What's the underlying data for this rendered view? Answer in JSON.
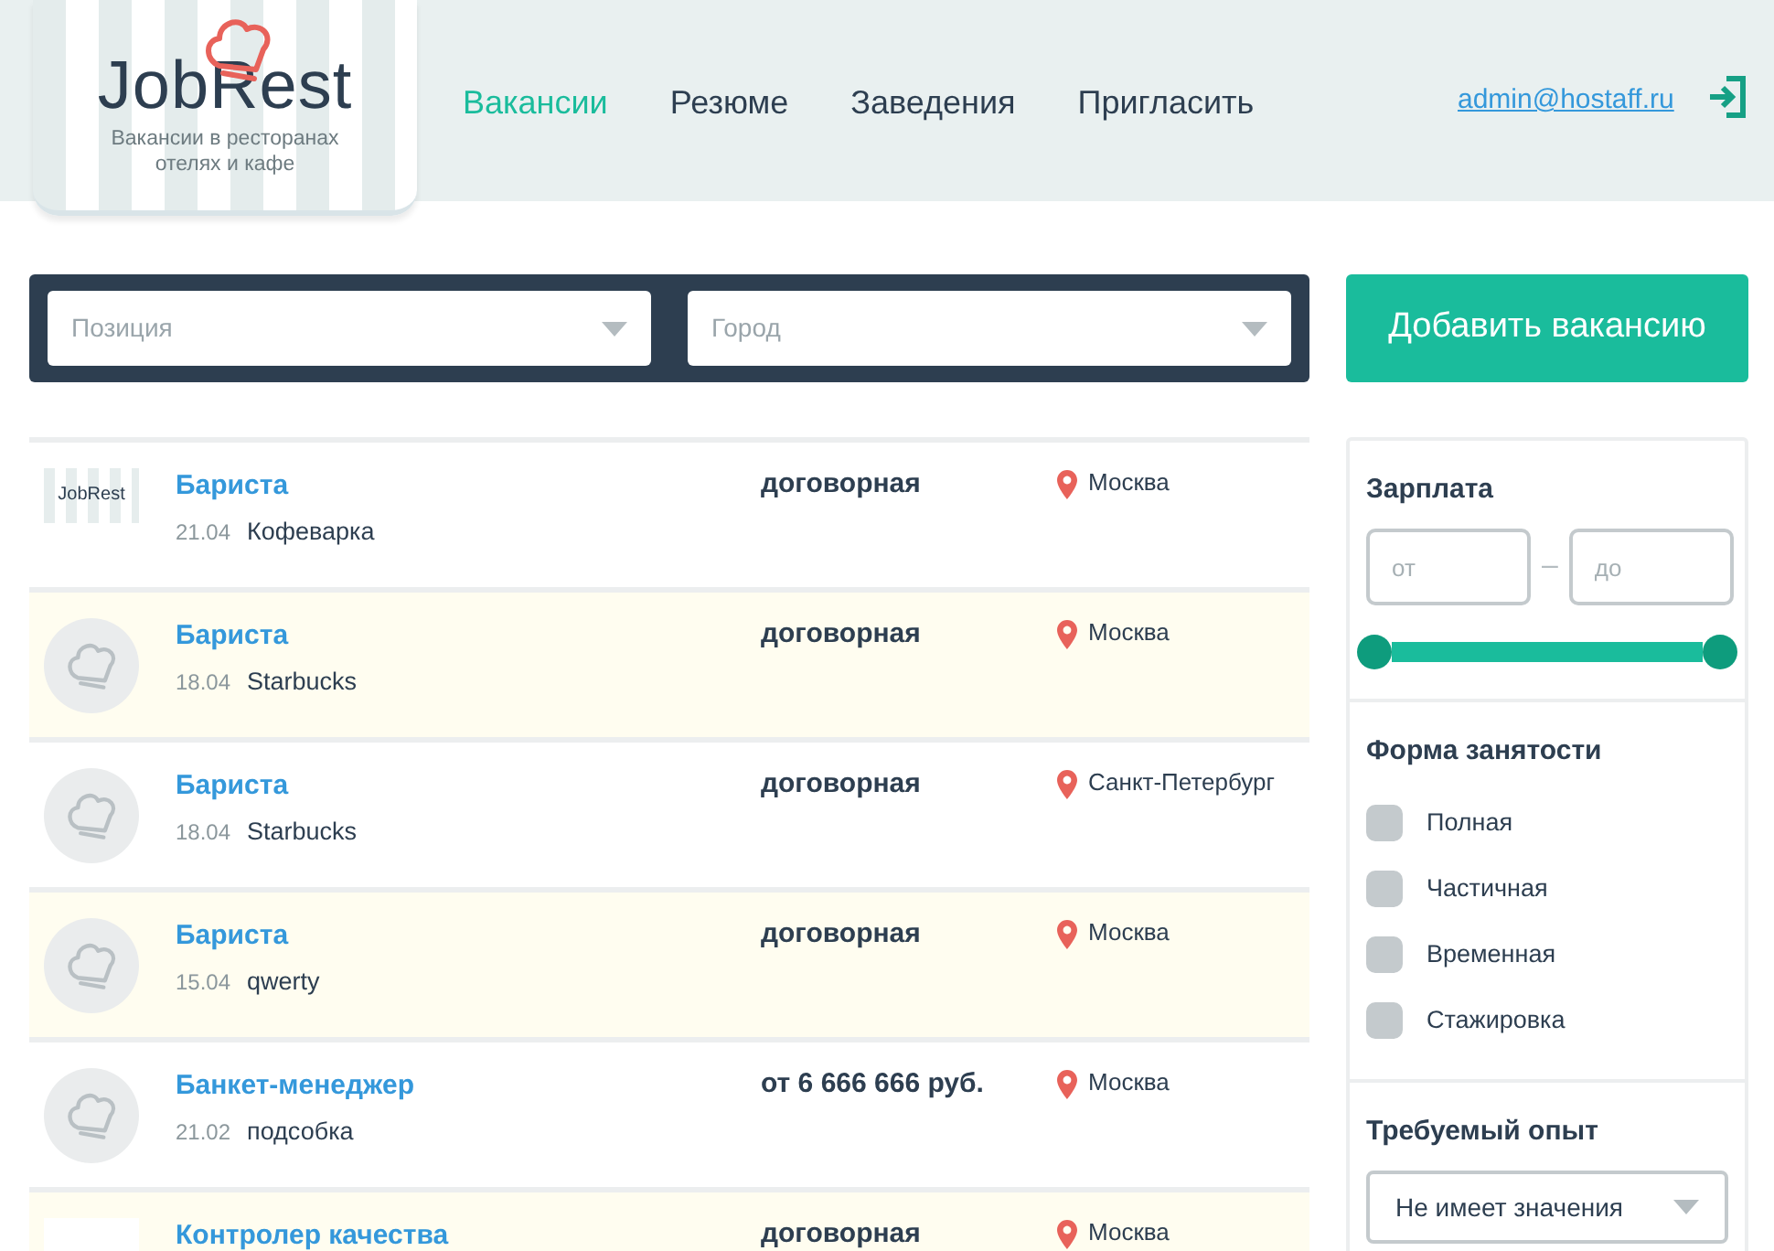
{
  "header": {
    "logo": {
      "name": "JobRest",
      "tagline": "Вакансии в ресторанах отелях и кафе"
    },
    "nav": [
      {
        "label": "Вакансии",
        "selected": true
      },
      {
        "label": "Резюме",
        "selected": false
      },
      {
        "label": "Заведения",
        "selected": false
      },
      {
        "label": "Пригласить",
        "selected": false
      }
    ],
    "user_email": "admin@hostaff.ru"
  },
  "search": {
    "position": {
      "placeholder": "Позиция"
    },
    "city": {
      "placeholder": "Город"
    }
  },
  "add_button": "Добавить вакансию",
  "vacancies": [
    {
      "kind": "logo",
      "logo_text": "JobRest",
      "highlighted": false,
      "title": "Бариста",
      "date": "21.04",
      "company": "Кофеварка",
      "salary": "договорная",
      "city": "Москва"
    },
    {
      "kind": "avatar",
      "highlighted": true,
      "title": "Бариста",
      "date": "18.04",
      "company": "Starbucks",
      "salary": "договорная",
      "city": "Москва"
    },
    {
      "kind": "avatar",
      "highlighted": false,
      "title": "Бариста",
      "date": "18.04",
      "company": "Starbucks",
      "salary": "договорная",
      "city": "Санкт-Петербург"
    },
    {
      "kind": "avatar",
      "highlighted": true,
      "title": "Бариста",
      "date": "15.04",
      "company": "qwerty",
      "salary": "договорная",
      "city": "Москва"
    },
    {
      "kind": "avatar",
      "highlighted": false,
      "title": "Банкет-менеджер",
      "date": "21.02",
      "company": "подсобка",
      "salary": "от 6 666 666 руб.",
      "city": "Москва"
    },
    {
      "kind": "blank",
      "highlighted": true,
      "title": "Контролер качества",
      "salary": "договорная",
      "city": "Москва"
    }
  ],
  "filters": {
    "salary": {
      "title": "Зарплата",
      "from": {
        "placeholder": "от"
      },
      "to": {
        "placeholder": "до"
      },
      "separator": "–",
      "thumbs": [
        {
          "level": 0
        },
        {
          "level": 1
        }
      ]
    },
    "employment": {
      "title": "Форма занятости",
      "options": [
        {
          "label": "Полная",
          "checked": false
        },
        {
          "label": "Частичная",
          "checked": false
        },
        {
          "label": "Временная",
          "checked": false
        },
        {
          "label": "Стажировка",
          "checked": false
        }
      ]
    },
    "experience": {
      "title": "Требуемый опыт",
      "value": "Не имеет значения"
    }
  }
}
